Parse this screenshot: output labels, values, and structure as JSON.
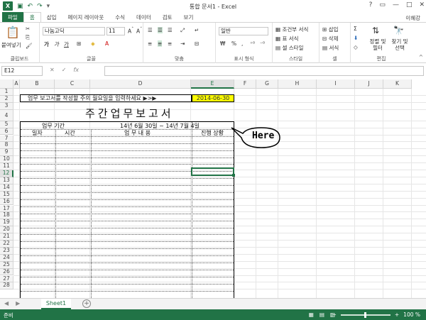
{
  "window": {
    "title": "통합 문서1 - Excel",
    "user": "이혜강",
    "app_icon": "excel-icon"
  },
  "tabs": [
    "파일",
    "홈",
    "삽입",
    "페이지 레이아웃",
    "수식",
    "데이터",
    "검토",
    "보기"
  ],
  "ribbon": {
    "clipboard": {
      "paste": "붙여넣기",
      "label": "클립보드"
    },
    "font": {
      "name": "나눔고딕",
      "size": "11",
      "label": "글꼴",
      "bold": "가",
      "italic": "가",
      "underline": "가"
    },
    "alignment": {
      "label": "맞춤"
    },
    "number": {
      "format": "일반",
      "percent": "%",
      "label": "표시 형식"
    },
    "styles": {
      "conditional": "조건부 서식",
      "table": "표 서식",
      "cell": "셀 스타일",
      "label": "스타일"
    },
    "cells": {
      "insert": "삽입",
      "delete": "삭제",
      "format": "서식",
      "label": "셀"
    },
    "editing": {
      "sort": "정렬 및 필터",
      "find": "찾기 및 선택",
      "label": "편집"
    }
  },
  "formula_bar": {
    "name_box": "E12",
    "value": ""
  },
  "columns": [
    "A",
    "B",
    "C",
    "D",
    "E",
    "F",
    "G",
    "H",
    "I",
    "J",
    "K"
  ],
  "selected_column": "E",
  "rows": [
    "1",
    "2",
    "3",
    "4",
    "5",
    "6",
    "7",
    "8",
    "9",
    "10",
    "11",
    "12",
    "13",
    "14",
    "15",
    "16",
    "17",
    "18",
    "19",
    "20",
    "21",
    "22",
    "23",
    "24",
    "25",
    "26",
    "27",
    "28"
  ],
  "selected_row": "12",
  "sheet": {
    "instruction": "업무 보고서를 작성할 주의 월요일을 입력하세요 ▶>▶",
    "date": "2014-06-30",
    "report_title": "주간업무보고서",
    "period_label": "업무 기간",
    "period_value": "14년 6월 30일 ~ 14년 7월 4일",
    "col_date": "일자",
    "col_time": "시간",
    "col_content": "업 무 내 용",
    "col_status": "진행 상황",
    "annotation": "Here"
  },
  "sheet_tabs": [
    "Sheet1"
  ],
  "status": {
    "ready": "준비",
    "zoom": "100 %"
  },
  "colors": {
    "accent": "#217346",
    "date_fill": "#ffff00"
  }
}
